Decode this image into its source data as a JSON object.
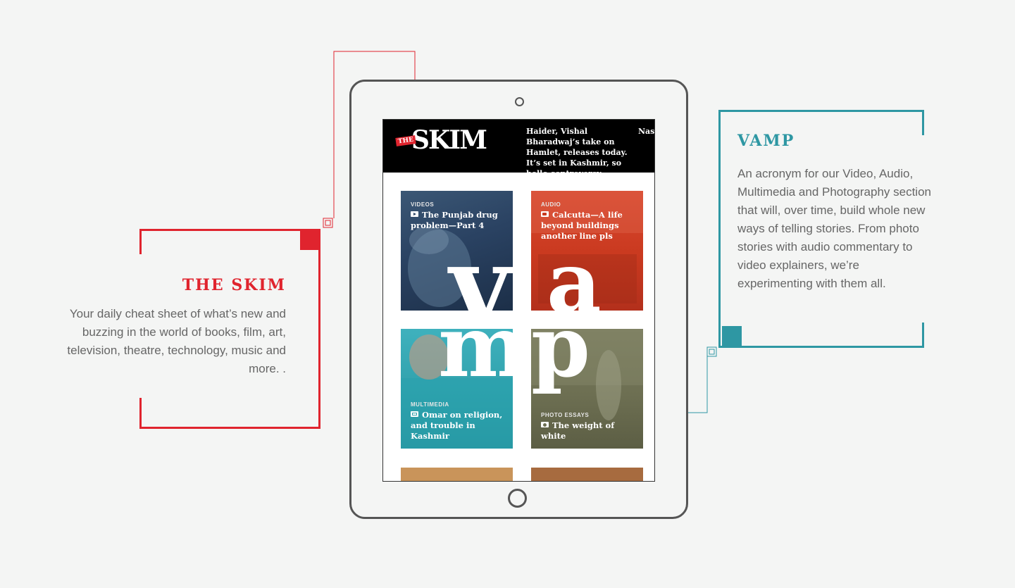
{
  "skim": {
    "title": "THE SKIM",
    "description": "Your daily cheat sheet of what’s new and buzzing  in the world of books, film, art, television, theatre, technology, music and more. ."
  },
  "vamp": {
    "title": "VAMP",
    "description": "An acronym for our Video, Audio, Multimedia and Photography section that will, over time, build whole new ways of telling stories. From  photo stories with audio commentary to video explainers, we’re experimenting with them all."
  },
  "app": {
    "logo_tag": "THE",
    "logo": "SKIM",
    "headline_1": "Haider, Vishal Bharadwaj’s take on Hamlet, releases today. It’s set in Kashmir, so hello controversy",
    "headline_2": "Nase auto ‘And not p",
    "big_letters": [
      "v",
      "a",
      "m",
      "p"
    ],
    "tiles": [
      {
        "category": "VIDEOS",
        "title": "The Punjab drug problem—Part 4",
        "icon": "play-icon"
      },
      {
        "category": "AUDIO",
        "title": "Calcutta—A life beyond buildings another line pls",
        "icon": "speaker-icon"
      },
      {
        "category": "MULTIMEDIA",
        "title": "Omar on religion, and trouble in Kashmir",
        "icon": "multimedia-icon"
      },
      {
        "category": "PHOTO ESSAYS",
        "title": "The weight of white",
        "icon": "camera-icon"
      }
    ]
  },
  "colors": {
    "skim_red": "#e0242e",
    "vamp_teal": "#2e97a3",
    "background": "#f4f5f4",
    "device_outline": "#555555"
  }
}
